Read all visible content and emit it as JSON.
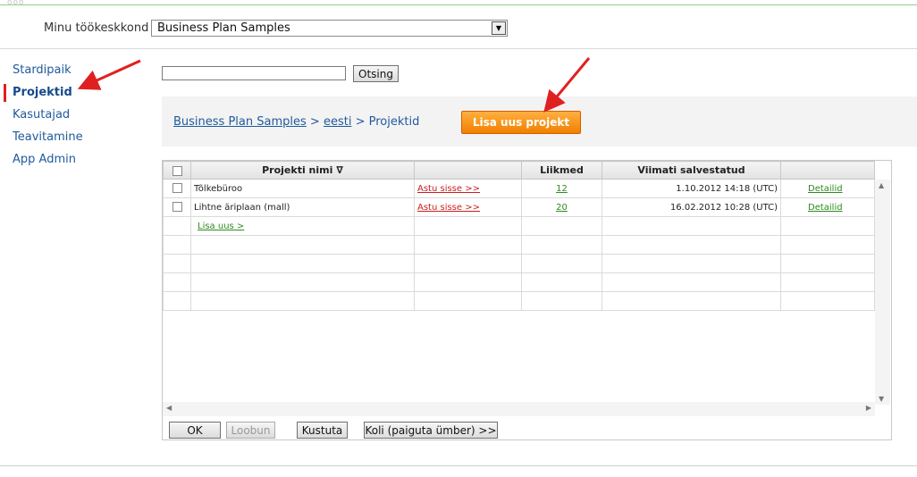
{
  "header": {
    "dots": "ooo",
    "workspace_label": "Minu töökeskkond",
    "workspace_selected": "Business Plan Samples"
  },
  "sidebar": {
    "items": [
      {
        "label": "Stardipaik"
      },
      {
        "label": "Projektid"
      },
      {
        "label": "Kasutajad"
      },
      {
        "label": "Teavitamine"
      },
      {
        "label": "App Admin"
      }
    ]
  },
  "search": {
    "value": "",
    "button_label": "Otsing"
  },
  "breadcrumb": {
    "root": "Business Plan Samples",
    "sep1": ">",
    "lang": "eesti",
    "sep2": ">",
    "current": "Projektid"
  },
  "new_project_button": "Lisa uus projekt",
  "table": {
    "headers": {
      "name": "Projekti nimi ∇",
      "enter": "",
      "members": "Liikmed",
      "saved": "Viimati salvestatud",
      "details": ""
    },
    "rows": [
      {
        "name": "Tõlkebüroo",
        "enter": "Astu sisse >>",
        "members": "12",
        "saved": "1.10.2012 14:18 (UTC)",
        "details": "Detailid"
      },
      {
        "name": "Lihtne äriplaan (mall)",
        "enter": "Astu sisse >>",
        "members": "20",
        "saved": "16.02.2012 10:28 (UTC)",
        "details": "Detailid"
      }
    ],
    "add_new": "Lisa uus >"
  },
  "scroll": {
    "up": "▲",
    "down": "▼",
    "left": "◀",
    "right": "▶"
  },
  "buttons": {
    "ok": "OK",
    "cancel": "Loobun",
    "delete": "Kustuta",
    "move": "Koli (paiguta ümber) >>"
  },
  "colors": {
    "accent_orange": "#f08000",
    "link_blue": "#1f5a9c",
    "link_red": "#cc1e1e",
    "link_green": "#2e8b1e",
    "annotation_red": "#e02020"
  }
}
